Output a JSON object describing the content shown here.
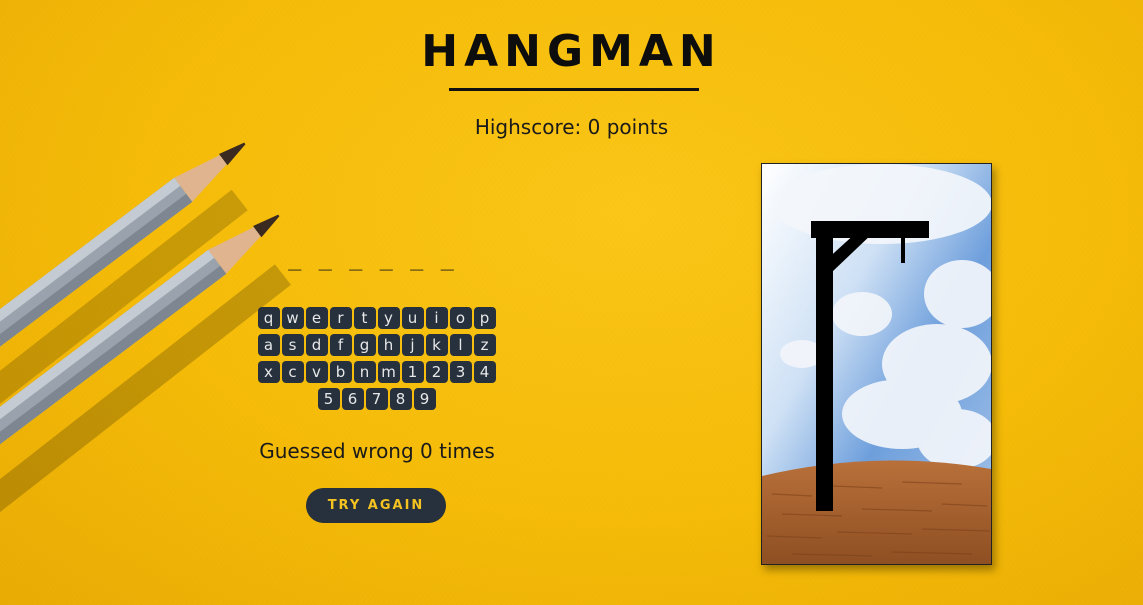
{
  "game": {
    "title": "HANGMAN",
    "highscore_label": "Highscore:",
    "highscore_value": "0",
    "highscore_unit": "points",
    "word_mask": "_ _ _ _ _ _",
    "wrong_label": "Guessed wrong",
    "wrong_count": "0",
    "wrong_unit": "times",
    "try_again_label": "TRY AGAIN"
  },
  "keyboard": {
    "keys": [
      "q",
      "w",
      "e",
      "r",
      "t",
      "y",
      "u",
      "i",
      "o",
      "p",
      "a",
      "s",
      "d",
      "f",
      "g",
      "h",
      "j",
      "k",
      "l",
      "z",
      "x",
      "c",
      "v",
      "b",
      "n",
      "m",
      "1",
      "2",
      "3",
      "4",
      "5",
      "6",
      "7",
      "8",
      "9"
    ]
  },
  "colors": {
    "background": "#f5bb07",
    "key_bg": "#26313d",
    "key_text": "#e7e7e7",
    "button_text": "#f5c220"
  }
}
